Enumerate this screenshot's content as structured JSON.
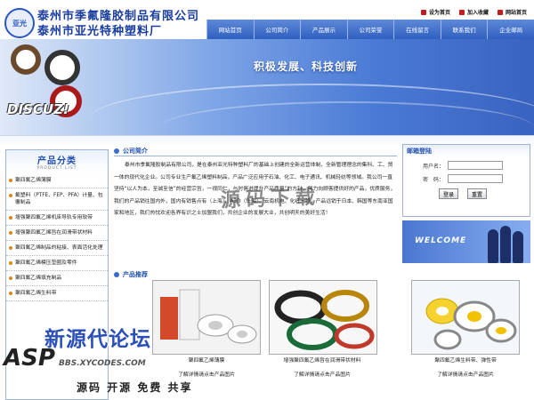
{
  "header": {
    "company_name_1": "泰州市季氟隆胶制品有限公司",
    "company_name_2": "泰州市亚光特种塑料厂",
    "logo_text": "亚光",
    "top_links": [
      {
        "label": "设为首页"
      },
      {
        "label": "加入收藏"
      },
      {
        "label": "网站首页"
      }
    ]
  },
  "nav": {
    "items": [
      "网站首页",
      "公司简介",
      "产品展示",
      "公司荣誉",
      "在线留言",
      "联系我们",
      "企业邮局"
    ]
  },
  "banner": {
    "slogan": "积极发展、科技创新",
    "watermark": "DISCUZ!"
  },
  "sidebar": {
    "title": "产品分类",
    "subtitle": "PRODUCT LIST",
    "items": [
      "聚四氟乙烯薄膜",
      "氟塑料（PTFE、FEP、PFA）计量、包覆制品",
      "增强聚四氟乙烯机床导轨专用软带",
      "增强聚四氟乙烯旨在润滑带状材料",
      "聚四氟乙烯制品的粘接、表面活化处理",
      "聚四氟乙烯模压垫圈及零件",
      "聚四氟乙烯填充制品",
      "聚四氟乙烯生料带"
    ]
  },
  "intro": {
    "title": "公司简介",
    "text": "泰州市季氟隆胶制品有限公司，是在泰州亚光特种塑料厂的基础上创建的全新运营体制，全新管理理念的集科、工、贸一体的现代化企业。公司专业生产氟乙烯塑料制品，产品广泛应用于石油、化工、电子通讯、机械轻纺等领域。我公司一直坚持“以人为本，至诚至信”的经营宗旨，一视同仁，与时俱进提升产品质量”的方针，努力向顾客提供好的产品，优质服务，我们的产品销往国内外，国内有销售点有（上海）、A3D（上海）、云南机电、化纤一等，产品远销于日本、韩国等东南亚国家和地区，我们热忱欢迎各界有识之士加盟我们，共创企业的发展大业，共创明天的美好生活！",
    "stamp": "源码下载"
  },
  "login": {
    "title": "邮箱登陆",
    "username_label": "用户名：",
    "password_label": "密　码：",
    "login_button": "登录",
    "reset_button": "重置"
  },
  "welcome": {
    "text": "WELCOME"
  },
  "products": {
    "title": "产品推荐",
    "items": [
      {
        "name": "聚四氟乙烯薄膜",
        "more": "了解详情请点击产品图片"
      },
      {
        "name": "增强聚四氟乙烯旨在润滑带状材料",
        "more": "了解详情请点击产品图片"
      },
      {
        "name": "聚四氟乙烯生料带、弹性带",
        "more": "了解详情请点击产品图片"
      }
    ]
  },
  "watermark": {
    "main": "新源代论坛",
    "asp": "ASP",
    "url": "BBS.XYCODES.COM",
    "tags": "源码 开源 免费 共享"
  },
  "colors": {
    "brand_blue": "#1f4fae",
    "nav_blue": "#2f5fc0",
    "bullet": "#d98a17"
  }
}
